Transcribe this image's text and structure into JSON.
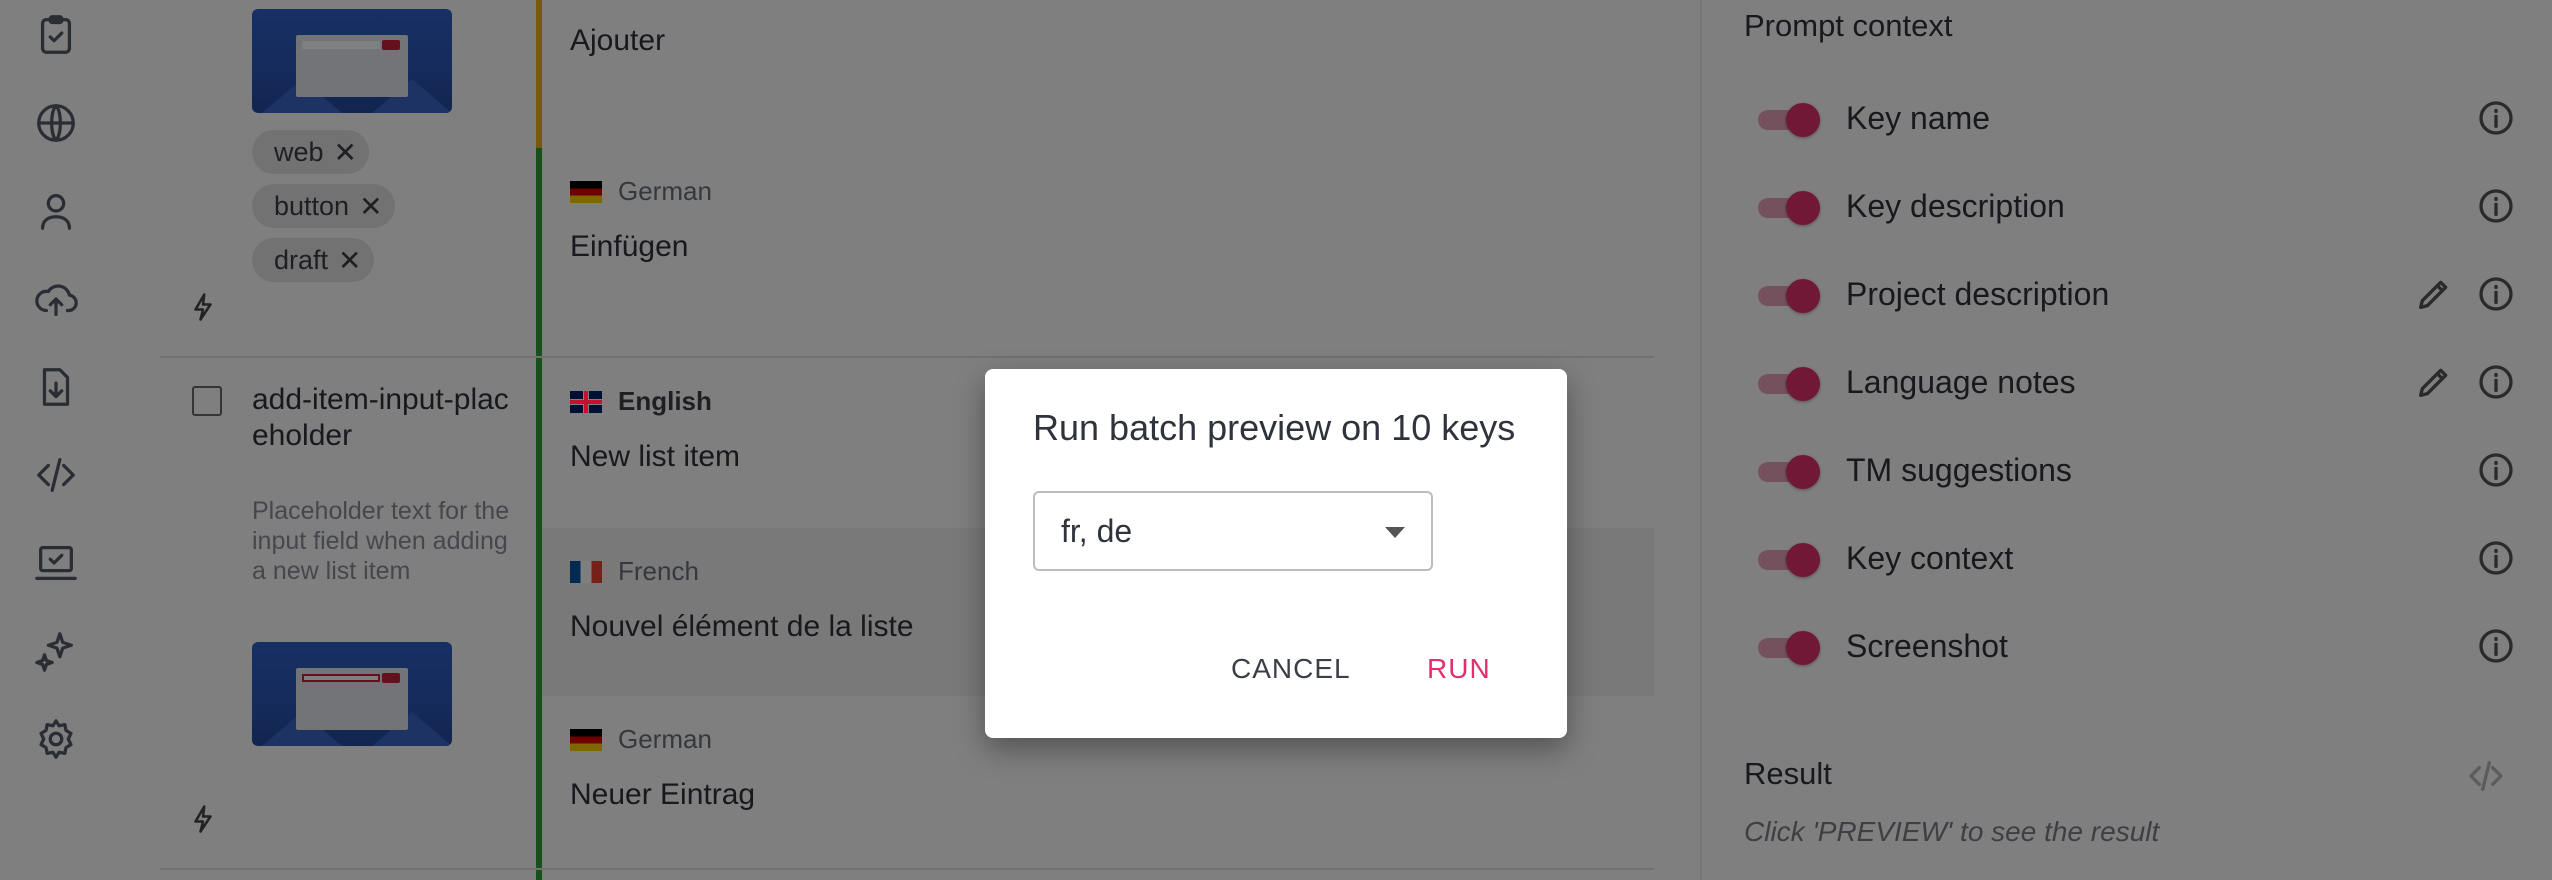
{
  "sidebar": {
    "icons": [
      "clipboard-check-icon",
      "globe-icon",
      "user-icon",
      "cloud-upload-icon",
      "file-download-icon",
      "code-icon",
      "laptop-check-icon",
      "sparkle-icon",
      "gear-icon"
    ]
  },
  "key_rows": [
    {
      "tags": [
        "web",
        "button",
        "draft"
      ],
      "translations": [
        {
          "text": "Ajouter"
        },
        {
          "language": "German",
          "text": "Einfügen"
        }
      ]
    },
    {
      "key_name": "add-item-input-placeholder",
      "description": "Placeholder text for the input field when adding a new list item",
      "translations": [
        {
          "language": "English",
          "text": "New list item"
        },
        {
          "language": "French",
          "text": "Nouvel élément de la liste"
        },
        {
          "language": "German",
          "text": "Neuer Eintrag"
        }
      ]
    }
  ],
  "right_panel": {
    "title": "Prompt context",
    "context_items": [
      {
        "label": "Key name",
        "enabled": true,
        "editable": false
      },
      {
        "label": "Key description",
        "enabled": true,
        "editable": false
      },
      {
        "label": "Project description",
        "enabled": true,
        "editable": true
      },
      {
        "label": "Language notes",
        "enabled": true,
        "editable": true
      },
      {
        "label": "TM suggestions",
        "enabled": true,
        "editable": false
      },
      {
        "label": "Key context",
        "enabled": true,
        "editable": false
      },
      {
        "label": "Screenshot",
        "enabled": true,
        "editable": false
      }
    ],
    "result_title": "Result",
    "result_hint": "Click 'PREVIEW' to see the result"
  },
  "dialog": {
    "title": "Run batch preview on 10 keys",
    "select_value": "fr, de",
    "cancel_label": "CANCEL",
    "run_label": "RUN"
  },
  "colors": {
    "accent": "#e1306c",
    "state_reviewed": "#2e9e3a",
    "state_pending": "#e6b420"
  }
}
